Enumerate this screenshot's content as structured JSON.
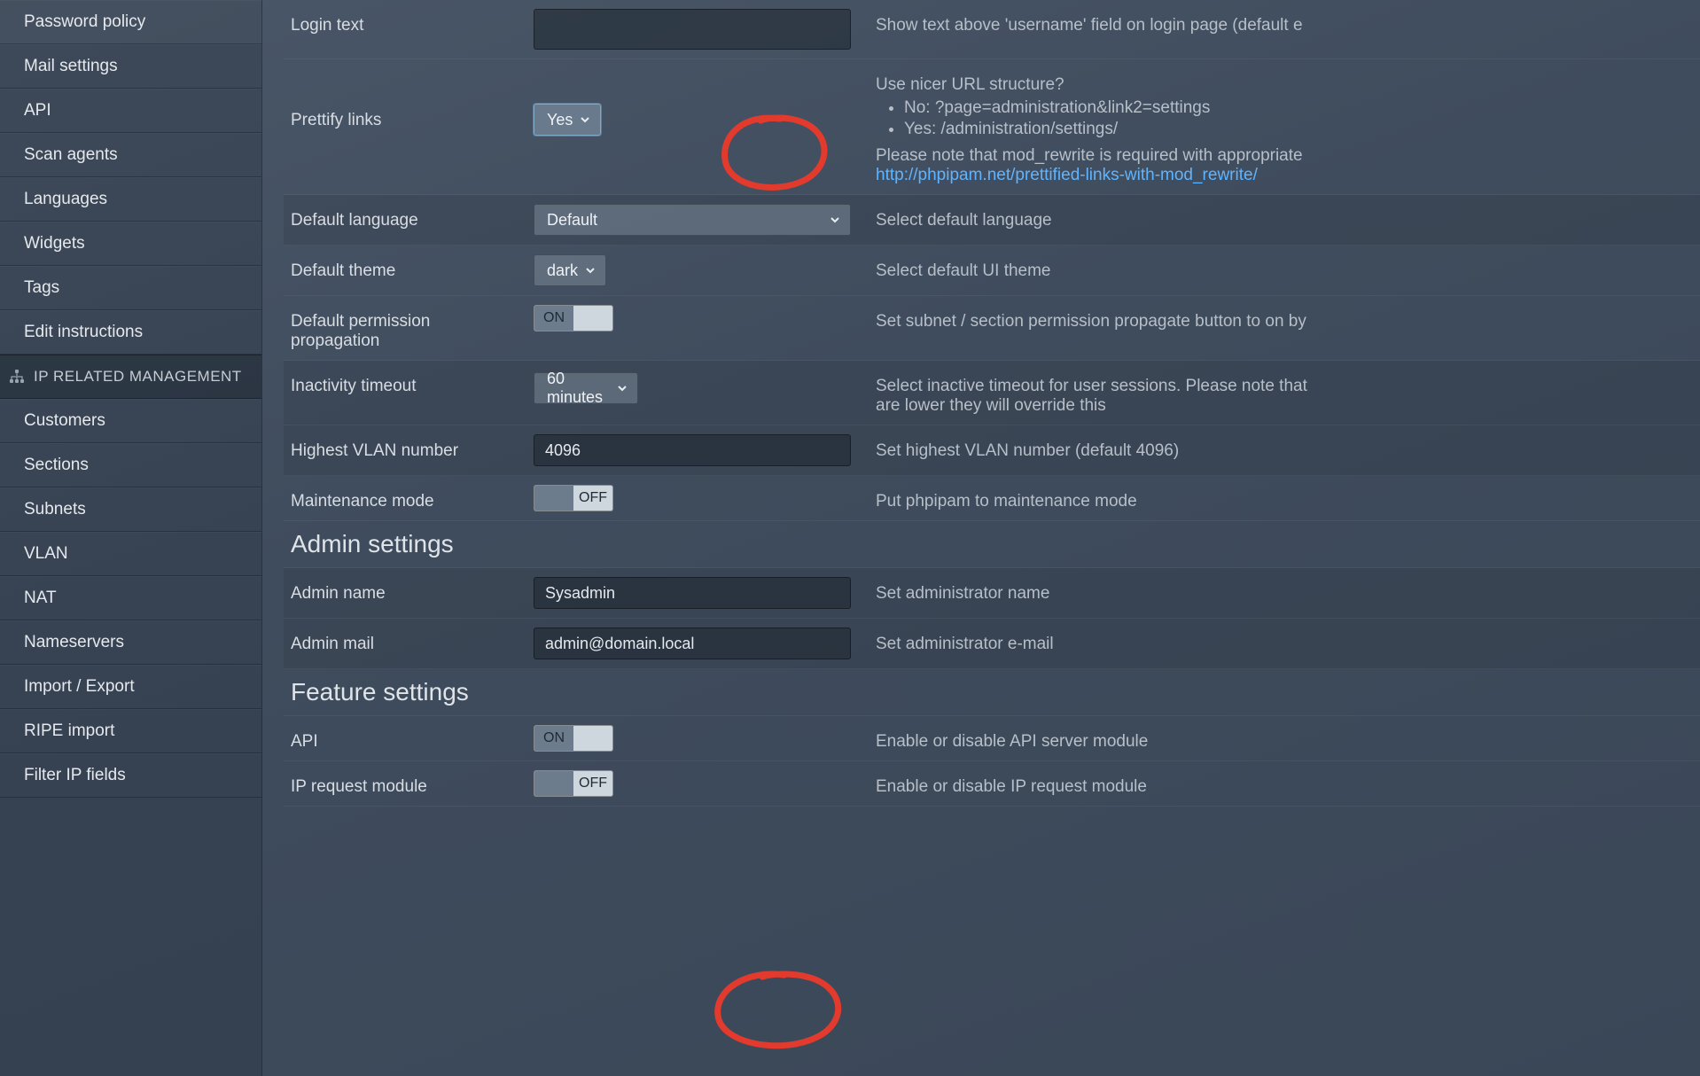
{
  "sidebar": {
    "items_top": [
      "Password policy",
      "Mail settings",
      "API",
      "Scan agents",
      "Languages",
      "Widgets",
      "Tags",
      "Edit instructions"
    ],
    "section_header": "IP RELATED MANAGEMENT",
    "items_ip": [
      "Customers",
      "Sections",
      "Subnets",
      "VLAN",
      "NAT",
      "Nameservers",
      "Import / Export",
      "RIPE import",
      "Filter IP fields"
    ]
  },
  "settings": {
    "login_text": {
      "label": "Login text",
      "value": "",
      "desc": "Show text above 'username' field on login page (default e"
    },
    "prettify": {
      "label": "Prettify links",
      "value": "Yes",
      "desc_lead": "Use nicer URL structure?",
      "bullet_no": "No: ?page=administration&link2=settings",
      "bullet_yes": "Yes: /administration/settings/",
      "desc_note": "Please note that mod_rewrite is required with appropriate",
      "link": "http://phpipam.net/prettified-links-with-mod_rewrite/"
    },
    "default_language": {
      "label": "Default language",
      "value": "Default",
      "desc": "Select default language"
    },
    "default_theme": {
      "label": "Default theme",
      "value": "dark",
      "desc": "Select default UI theme"
    },
    "perm_propagation": {
      "label": "Default permission propagation",
      "value": "ON",
      "desc": "Set subnet / section permission propagate button to on by"
    },
    "inactivity": {
      "label": "Inactivity timeout",
      "value": "60 minutes",
      "desc": "Select inactive timeout for user sessions. Please note that",
      "desc2": "are lower they will override this"
    },
    "highest_vlan": {
      "label": "Highest VLAN number",
      "value": "4096",
      "desc": "Set highest VLAN number (default 4096)"
    },
    "maintenance": {
      "label": "Maintenance mode",
      "value": "OFF",
      "desc": "Put phpipam to maintenance mode"
    }
  },
  "admin": {
    "title": "Admin settings",
    "name": {
      "label": "Admin name",
      "value": "Sysadmin",
      "desc": "Set administrator name"
    },
    "mail": {
      "label": "Admin mail",
      "value": "admin@domain.local",
      "desc": "Set administrator e-mail"
    }
  },
  "features": {
    "title": "Feature settings",
    "api": {
      "label": "API",
      "value": "ON",
      "desc": "Enable or disable API server module"
    },
    "ip_request": {
      "label": "IP request module",
      "value": "OFF",
      "desc": "Enable or disable IP request module"
    }
  }
}
